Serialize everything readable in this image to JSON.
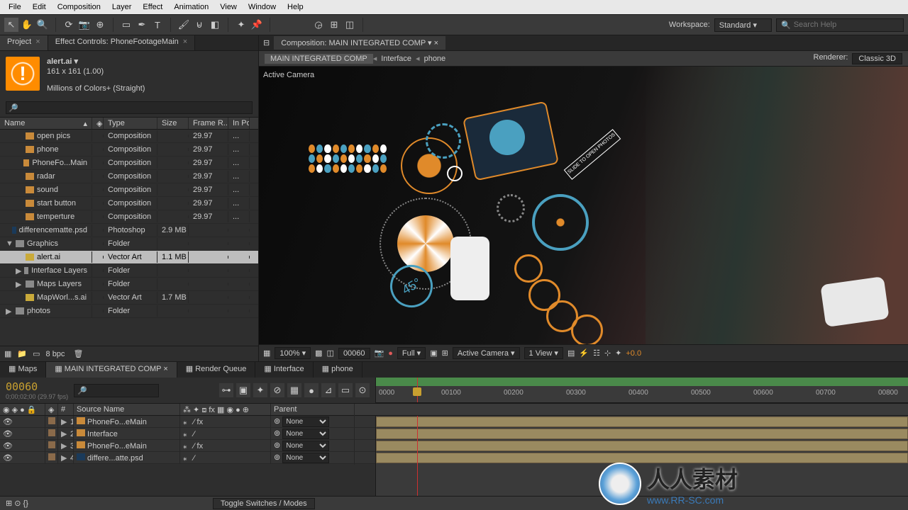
{
  "menu": [
    "File",
    "Edit",
    "Composition",
    "Layer",
    "Effect",
    "Animation",
    "View",
    "Window",
    "Help"
  ],
  "workspace": {
    "label": "Workspace:",
    "value": "Standard"
  },
  "search": {
    "placeholder": "Search Help"
  },
  "project_panel": {
    "tab1": "Project",
    "tab2": "Effect Controls: PhoneFootageMain",
    "selected_item": "alert.ai ▾",
    "dimensions": "161 x 161 (1.00)",
    "colors": "Millions of Colors+ (Straight)",
    "columns": {
      "name": "Name",
      "type": "Type",
      "size": "Size",
      "fr": "Frame R...",
      "inp": "In Po..."
    },
    "items": [
      {
        "name": "open pics",
        "type": "Composition",
        "size": "",
        "fr": "29.97",
        "icon": "comp",
        "indent": 1,
        "inp": "..."
      },
      {
        "name": "phone",
        "type": "Composition",
        "size": "",
        "fr": "29.97",
        "icon": "comp",
        "indent": 1,
        "inp": "..."
      },
      {
        "name": "PhoneFo...Main",
        "type": "Composition",
        "size": "",
        "fr": "29.97",
        "icon": "comp",
        "indent": 1,
        "inp": "..."
      },
      {
        "name": "radar",
        "type": "Composition",
        "size": "",
        "fr": "29.97",
        "icon": "comp",
        "indent": 1,
        "inp": "..."
      },
      {
        "name": "sound",
        "type": "Composition",
        "size": "",
        "fr": "29.97",
        "icon": "comp",
        "indent": 1,
        "inp": "..."
      },
      {
        "name": "start button",
        "type": "Composition",
        "size": "",
        "fr": "29.97",
        "icon": "comp",
        "indent": 1,
        "inp": "..."
      },
      {
        "name": "temperture",
        "type": "Composition",
        "size": "",
        "fr": "29.97",
        "icon": "comp",
        "indent": 1,
        "inp": "..."
      },
      {
        "name": "differencematte.psd",
        "type": "Photoshop",
        "size": "2.9 MB",
        "fr": "",
        "icon": "ps",
        "indent": 0,
        "inp": ""
      },
      {
        "name": "Graphics",
        "type": "Folder",
        "size": "",
        "fr": "",
        "icon": "folder",
        "indent": 0,
        "twirl": "▼",
        "inp": ""
      },
      {
        "name": "alert.ai",
        "type": "Vector Art",
        "size": "1.1 MB",
        "fr": "",
        "icon": "ai",
        "indent": 1,
        "selected": true,
        "inp": ""
      },
      {
        "name": "Interface Layers",
        "type": "Folder",
        "size": "",
        "fr": "",
        "icon": "folder",
        "indent": 1,
        "twirl": "▶",
        "inp": ""
      },
      {
        "name": "Maps Layers",
        "type": "Folder",
        "size": "",
        "fr": "",
        "icon": "folder",
        "indent": 1,
        "twirl": "▶",
        "inp": ""
      },
      {
        "name": "MapWorl...s.ai",
        "type": "Vector Art",
        "size": "1.7 MB",
        "fr": "",
        "icon": "ai",
        "indent": 1,
        "inp": ""
      },
      {
        "name": "photos",
        "type": "Folder",
        "size": "",
        "fr": "",
        "icon": "folder",
        "indent": 0,
        "twirl": "▶",
        "inp": ""
      }
    ],
    "bpc": "8 bpc"
  },
  "viewer": {
    "tab": "Composition: MAIN INTEGRATED COMP",
    "breadcrumbs": [
      "MAIN INTEGRATED COMP",
      "Interface",
      "phone"
    ],
    "renderer_label": "Renderer:",
    "renderer_value": "Classic 3D",
    "active_camera": "Active Camera",
    "footer": {
      "zoom": "100%",
      "frame": "00060",
      "res": "Full",
      "camera": "Active Camera",
      "views": "1 View",
      "exposure": "+0.0"
    }
  },
  "timeline": {
    "tabs": [
      "Maps",
      "MAIN INTEGRATED COMP",
      "Render Queue",
      "Interface",
      "phone"
    ],
    "active_tab": 1,
    "timecode": "00060",
    "timecode_sub": "0;00;02;00 (29.97 fps)",
    "ruler": [
      "0000",
      "00100",
      "00200",
      "00300",
      "00400",
      "00500",
      "00600",
      "00700",
      "00800"
    ],
    "columns": {
      "source": "Source Name",
      "parent": "Parent"
    },
    "layers": [
      {
        "num": "1",
        "name": "PhoneFo...eMain",
        "parent": "None",
        "badge": "fx",
        "icon": "comp"
      },
      {
        "num": "2",
        "name": "Interface",
        "parent": "None",
        "badge": "",
        "icon": "comp"
      },
      {
        "num": "3",
        "name": "PhoneFo...eMain",
        "parent": "None",
        "badge": "fx",
        "icon": "comp"
      },
      {
        "num": "4",
        "name": "differe...atte.psd",
        "parent": "None",
        "badge": "",
        "icon": "ps"
      }
    ],
    "footer": "Toggle Switches / Modes"
  },
  "watermark": {
    "text": "人人素材",
    "sub": "www.RR-SC.com"
  }
}
